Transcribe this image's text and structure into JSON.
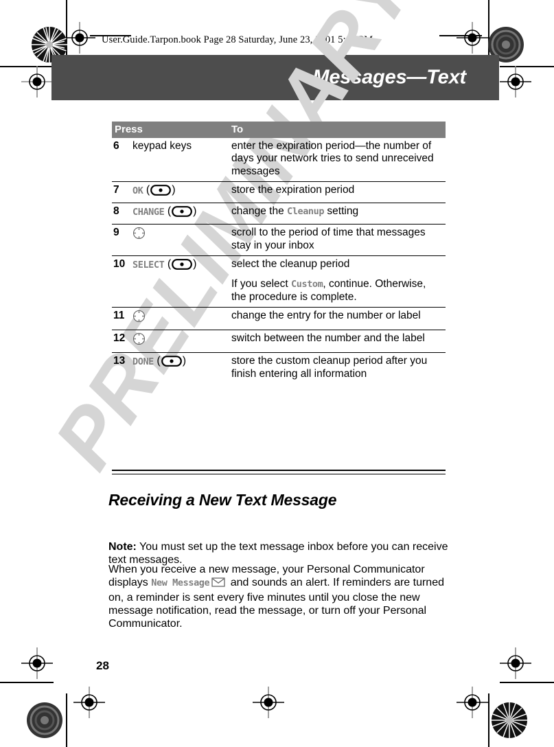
{
  "page": {
    "file_header": "User.Guide.Tarpon.book  Page 28  Saturday, June 23, 2001  5:03 PM",
    "chapter_title": "Messages—Text",
    "watermark": "PRELIMINARY",
    "page_number": "28"
  },
  "table": {
    "headers": {
      "press": "Press",
      "to": "To"
    },
    "rows": [
      {
        "num": "6",
        "press_text": "keypad keys",
        "press_key": "",
        "press_icon": "",
        "to": "enter the expiration period—the number of days your network tries to send unreceived messages",
        "to_extra": ""
      },
      {
        "num": "7",
        "press_text": "",
        "press_key": "OK",
        "press_icon": "softkey-button-icon",
        "to": "store the expiration period",
        "to_extra": ""
      },
      {
        "num": "8",
        "press_text": "",
        "press_key": "CHANGE",
        "press_icon": "softkey-button-icon",
        "to_pre": "change the ",
        "to_mono": "Cleanup",
        "to_post": " setting",
        "to": "",
        "to_extra": ""
      },
      {
        "num": "9",
        "press_text": "",
        "press_key": "",
        "press_icon": "navigation-wheel-icon",
        "to": "scroll to the period of time that messages stay in your inbox",
        "to_extra": ""
      },
      {
        "num": "10",
        "press_text": "",
        "press_key": "SELECT",
        "press_icon": "softkey-button-icon",
        "to": "select the cleanup period",
        "to_extra_pre": "If you select ",
        "to_extra_mono": "Custom",
        "to_extra_post": ", continue. Otherwise, the procedure is complete."
      },
      {
        "num": "11",
        "press_text": "",
        "press_key": "",
        "press_icon": "navigation-wheel-icon",
        "to": "change the entry for the number or label",
        "to_extra": ""
      },
      {
        "num": "12",
        "press_text": "",
        "press_key": "",
        "press_icon": "navigation-wheel-icon",
        "to": "switch between the number and the label",
        "to_extra": ""
      },
      {
        "num": "13",
        "press_text": "",
        "press_key": "DONE",
        "press_icon": "softkey-button-icon",
        "to": "store the custom cleanup period after you finish entering all information",
        "to_extra": ""
      }
    ]
  },
  "section": {
    "heading": "Receiving a New Text Message",
    "note_label": "Note:",
    "note_body": " You must set up the text message inbox before you can receive text messages.",
    "para2_pre": "When you receive a new message, your Personal Communicator displays ",
    "para2_mono": "New Message",
    "para2_icon": "envelope-icon",
    "para2_post": " and sounds an alert. If reminders are turned on, a reminder is sent every five minutes until you close the new message notification, read the message, or turn off your Personal Communicator."
  },
  "colors": {
    "banner": "#4d4d4d",
    "table_header": "#7f7f7f",
    "mono_gray": "#808080",
    "watermark": "#d5d5d5"
  }
}
